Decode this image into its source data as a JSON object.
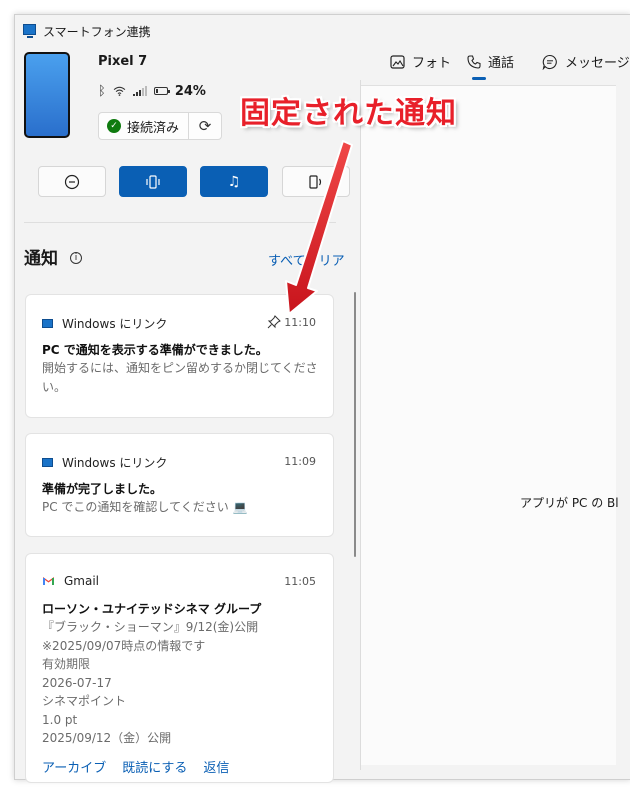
{
  "window": {
    "title": "スマートフォン連携"
  },
  "device": {
    "name": "Pixel 7",
    "battery_percent": "24%",
    "battery_level": 0.24,
    "connection_status": "接続済み"
  },
  "tabs": [
    {
      "label": "フォト"
    },
    {
      "label": "通話"
    },
    {
      "label": "メッセージ"
    }
  ],
  "notifications": {
    "heading": "通知",
    "clear_all": "すべてクリア",
    "items": [
      {
        "app": "Windows にリンク",
        "time": "11:10",
        "title": "PC で通知を表示する準備ができました。",
        "body": "開始するには、通知をピン留めするか閉じてください。"
      },
      {
        "app": "Windows にリンク",
        "time": "11:09",
        "title": "準備が完了しました。",
        "body": "PC でこの通知を確認してください 💻"
      },
      {
        "app": "Gmail",
        "time": "11:05",
        "title": "ローソン・ユナイテッドシネマ グループ",
        "body_lines": [
          "『ブラック・ショーマン』9/12(金)公開",
          "※2025/09/07時点の情報です",
          "有効期限",
          "2026-07-17",
          "シネマポイント",
          "1.0 pt",
          "2025/09/12（金）公開"
        ],
        "actions": [
          "アーカイブ",
          "既読にする",
          "返信"
        ]
      }
    ]
  },
  "right_panel": {
    "message": "アプリが PC の Bl"
  },
  "annotation": {
    "text": "固定された通知",
    "color": "#e8202a"
  }
}
